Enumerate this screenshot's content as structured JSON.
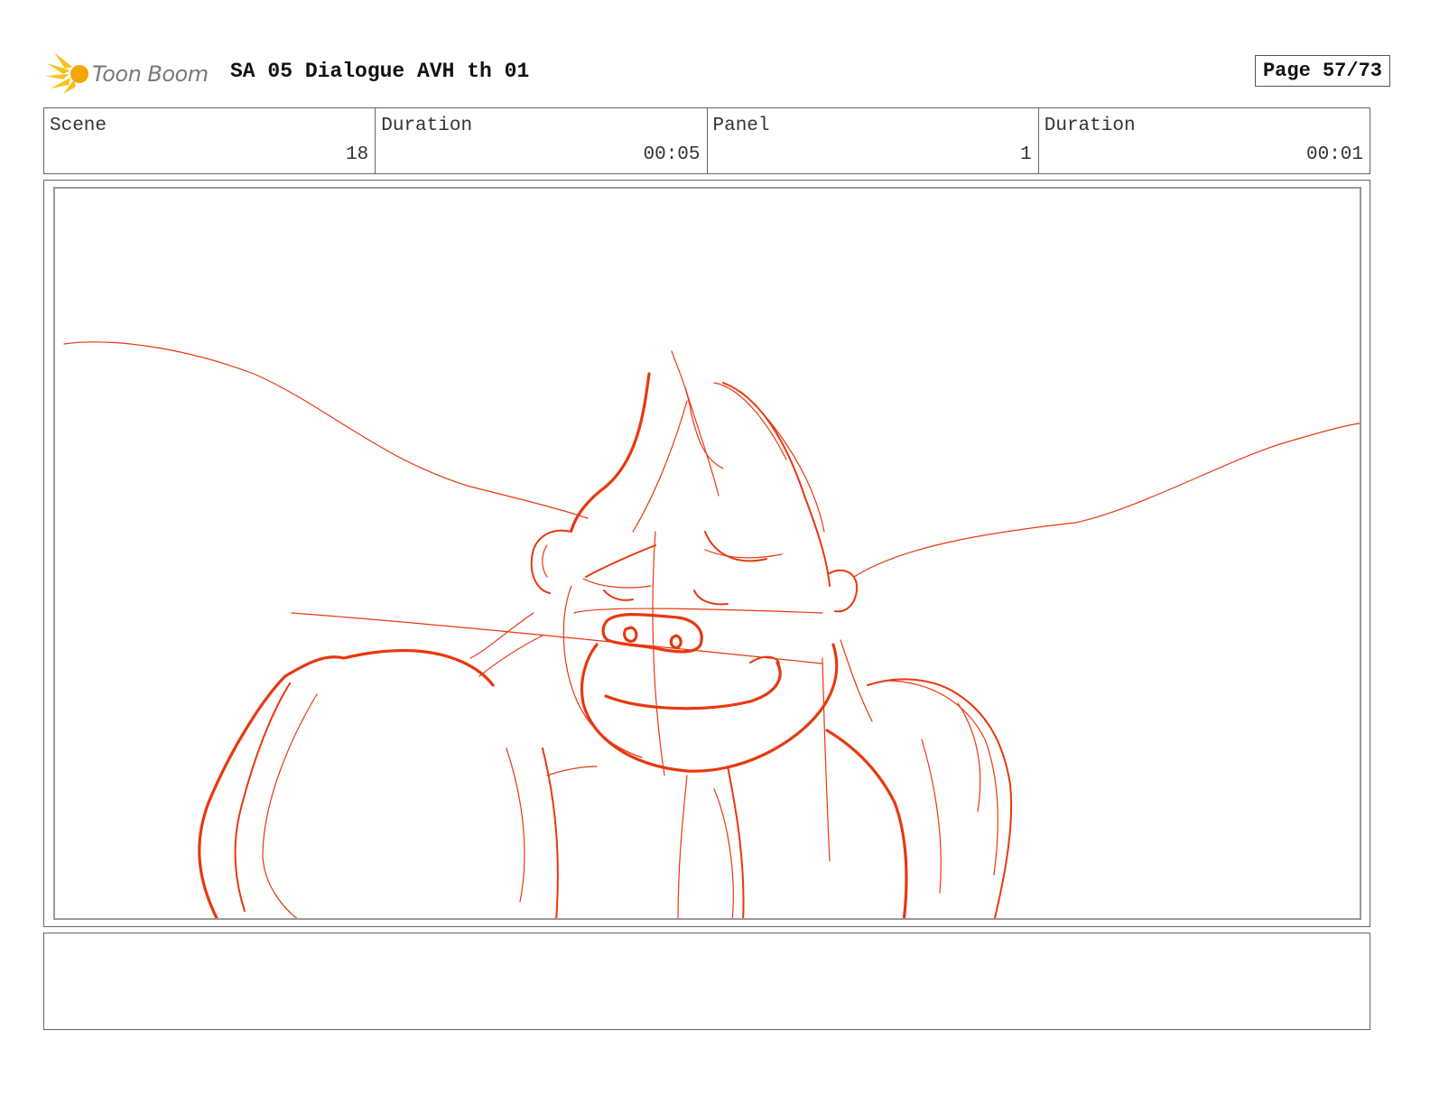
{
  "header": {
    "brand": "Toon Boom",
    "title": "SA 05 Dialogue AVH th 01",
    "page": "Page 57/73"
  },
  "info": [
    {
      "label": "Scene",
      "value": "18"
    },
    {
      "label": "Duration",
      "value": "00:05"
    },
    {
      "label": "Panel",
      "value": "1"
    },
    {
      "label": "Duration",
      "value": "00:01"
    }
  ],
  "colors": {
    "sketch_stroke": "#e8380f",
    "logo_yellow": "#f6c21c"
  },
  "icons": {
    "logo": "toon-boom-logo-icon"
  },
  "notes": ""
}
